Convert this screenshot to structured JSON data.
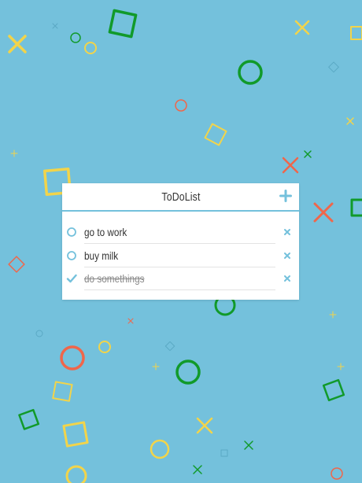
{
  "app": {
    "title": "ToDoList"
  },
  "colors": {
    "background": "#74c1dc",
    "accent": "#74c1dc",
    "yellow": "#f2d44a",
    "green": "#119a2a",
    "red": "#f0664a",
    "card": "#ffffff"
  },
  "todos": [
    {
      "text": "go to work",
      "done": false
    },
    {
      "text": "buy milk",
      "done": false
    },
    {
      "text": "do somethings",
      "done": true
    }
  ],
  "icons": {
    "add": "plus-icon",
    "pending": "circle-icon",
    "done": "check-icon",
    "delete": "close-icon"
  }
}
